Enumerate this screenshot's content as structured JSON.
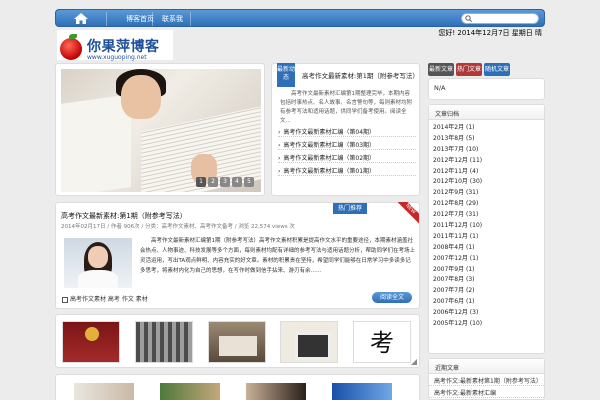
{
  "nav": {
    "items": [
      "博客首页",
      "联系我"
    ],
    "search_placeholder": ""
  },
  "header": {
    "greeting": "您好! 2014年12月7日 星期日  晴",
    "logo_text": "你果萍博客",
    "logo_url": "www.xuguoping.net"
  },
  "slideshow": {
    "pages": [
      "1",
      "2",
      "3",
      "4",
      "5"
    ]
  },
  "news": {
    "badge": "最新动态",
    "title": "高考作文最新素材:第1期（附参考写法）",
    "excerpt": "　　高考作文最新素材汇编第1期整理完毕，本期内容 包括时事热点、名人故事、名言警句等，每则素材均附有参考写法和适用话题，供同学们备考使用。阅读全文...",
    "items": [
      "高考作文最新素材汇编（第04期）",
      "高考作文最新素材汇编（第03期）",
      "高考作文最新素材汇编（第02期）",
      "高考作文最新素材汇编（第01期）"
    ]
  },
  "sidebar": {
    "tabs": [
      "最新文章",
      "热门文章",
      "随机文章"
    ],
    "tab_content": "N/A",
    "archive_title": "文章归档",
    "archive": [
      "2014年2月 (1)",
      "2013年8月 (5)",
      "2013年7月 (10)",
      "2012年12月 (11)",
      "2012年11月 (4)",
      "2012年10月 (30)",
      "2012年9月 (31)",
      "2012年8月 (29)",
      "2012年7月 (31)",
      "2011年12月 (10)",
      "2011年11月 (1)",
      "2008年4月 (1)",
      "2007年12月 (1)",
      "2007年9月 (1)",
      "2007年8月 (3)",
      "2007年7月 (2)",
      "2007年6月 (1)",
      "2006年12月 (3)",
      "2005年12月 (10)"
    ],
    "recent_title": "近期文章",
    "recent": [
      "高考作文:最新素材第1期（附参考写法）",
      "高考作文:最新素材汇编"
    ]
  },
  "article": {
    "tag": "热门推荐",
    "new_label": "NEW",
    "title": "高考作文最新素材:第1期（附参考写法）",
    "meta": "2014年02月17日 / 作者 906次 / 分类：高考作文素材、高考作文备考 / 浏览 22,574 views 次",
    "body": "　　高考作文最新素材汇编第1期（附参考写法）高考作文素材积累是提高作文水平的重要途径，本期素材涵盖社会热点、人物事迹、科技发展等多个方面，每则素材均配有详细的参考写法与适用话题分析，帮助同学们在考场上灵活运用，写出TA观点鲜明、内容充实的好文章。素材的积累贵在坚持，希望同学们能够在日常学习中多读多记多思考，将素材内化为自己的思想，在写作时做到信手拈来、游刃有余……",
    "footer": "高考作文素材  高考  作文  素材",
    "more": "阅读全文"
  },
  "gallery": {
    "thumb5_char": "考"
  }
}
